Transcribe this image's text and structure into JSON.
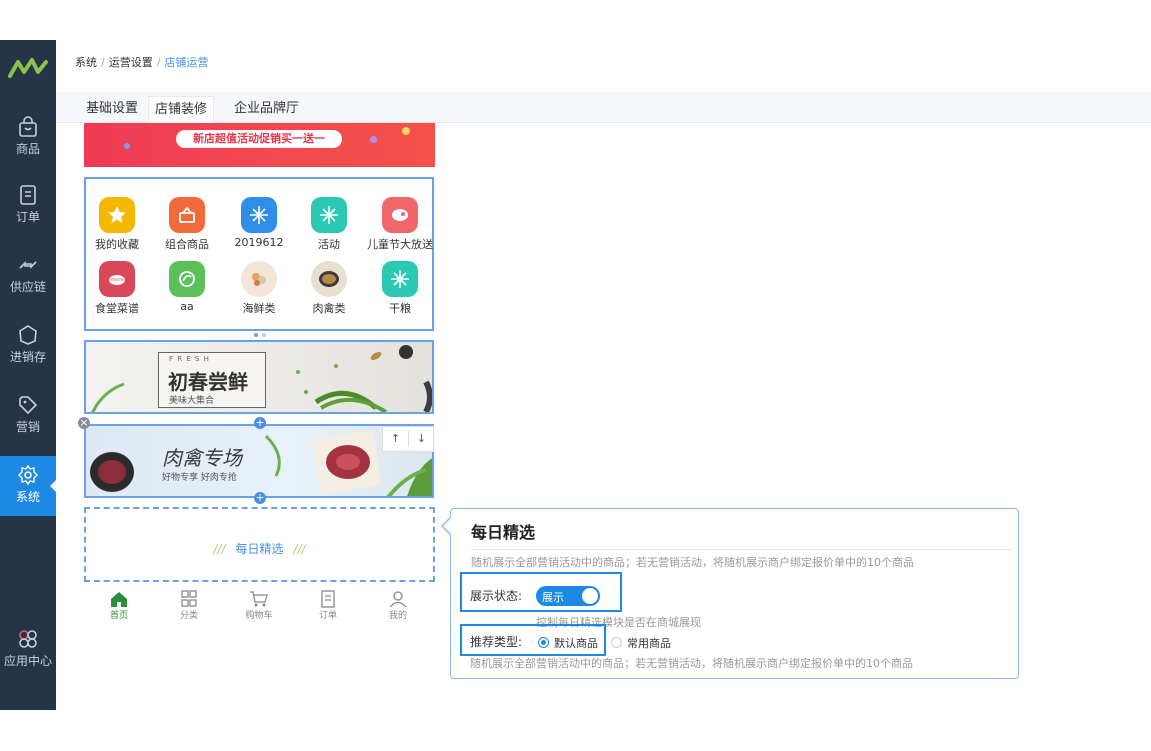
{
  "sidebar": {
    "items": [
      {
        "label": "商品",
        "icon": "bag-icon"
      },
      {
        "label": "订单",
        "icon": "document-icon"
      },
      {
        "label": "供应链",
        "icon": "exchange-icon"
      },
      {
        "label": "进销存",
        "icon": "inventory-icon"
      },
      {
        "label": "营销",
        "icon": "tag-icon"
      },
      {
        "label": "系统",
        "icon": "gear-icon",
        "active": true
      },
      {
        "label": "应用中心",
        "icon": "app-center-icon"
      }
    ]
  },
  "breadcrumb": [
    "系统",
    "运营设置",
    "店铺运营"
  ],
  "tabs": [
    "基础设置",
    "店铺装修",
    "企业品牌厅"
  ],
  "active_tab": "店铺装修",
  "preview": {
    "top_banner": "新店超值活动促销买一送一",
    "grid_items": [
      {
        "label": "我的收藏",
        "color": "#f5b800"
      },
      {
        "label": "组合商品",
        "color": "#f26a3b"
      },
      {
        "label": "2019612",
        "color": "#2f8ee8"
      },
      {
        "label": "活动",
        "color": "#2bc9b4"
      },
      {
        "label": "儿童节大放送",
        "color": "#f0666a"
      },
      {
        "label": "食堂菜谱",
        "color": "#d9475a"
      },
      {
        "label": "aa",
        "color": "#5cc05a"
      },
      {
        "label": "海鲜类",
        "color": "#e0b083"
      },
      {
        "label": "肉禽类",
        "color": "#9b7a4c"
      },
      {
        "label": "干粮",
        "color": "#2bc9b4"
      }
    ],
    "fresh_banner": {
      "eyebrow": "F R E S H",
      "title": "初春尝鲜",
      "subtitle": "美味大集合"
    },
    "meat_banner": {
      "title": "肉禽专场",
      "subtitle": "好物专享 好肉专抢"
    },
    "move_up": "↑",
    "move_down": "↓",
    "daily_pick_title": "每日精选",
    "daily_pick_slash": "///",
    "tabbar": [
      {
        "label": "首页",
        "icon": "home-icon",
        "active": true
      },
      {
        "label": "分类",
        "icon": "category-icon"
      },
      {
        "label": "购物车",
        "icon": "cart-icon"
      },
      {
        "label": "订单",
        "icon": "order-icon"
      },
      {
        "label": "我的",
        "icon": "user-icon"
      }
    ]
  },
  "panel": {
    "title": "每日精选",
    "description": "随机展示全部营销活动中的商品；若无营销活动，将随机展示商户绑定报价单中的10个商品",
    "display_status_label": "展示状态:",
    "display_switch_text": "展示",
    "display_switch_on": true,
    "display_hint": "控制每日精选模块是否在商城展现",
    "recommend_type_label": "推荐类型:",
    "options": [
      "默认商品",
      "常用商品"
    ],
    "selected_option": "默认商品",
    "recommend_hint": "随机展示全部营销活动中的商品；若无营销活动，将随机展示商户绑定报价单中的10个商品"
  }
}
